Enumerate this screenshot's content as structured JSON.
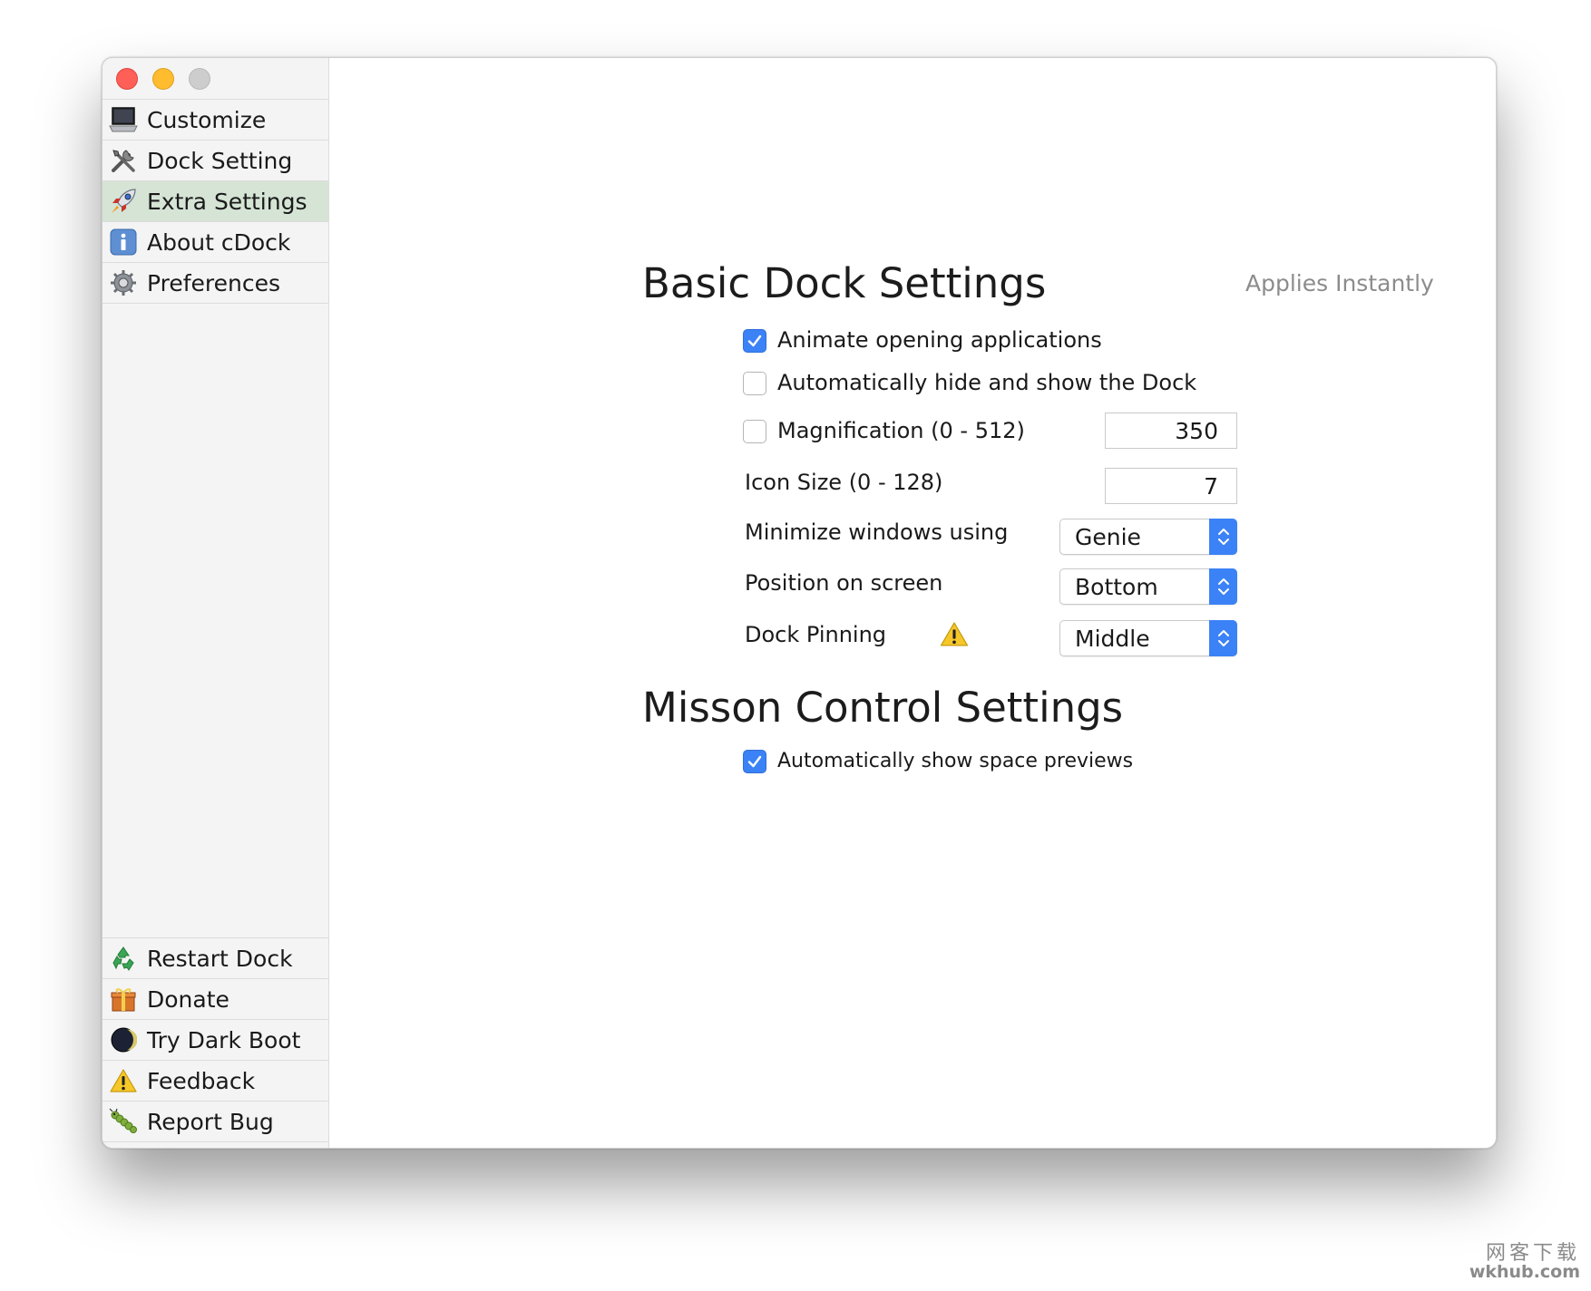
{
  "sidebar": {
    "top_items": [
      {
        "label": "Customize",
        "icon": "laptop-icon"
      },
      {
        "label": "Dock Setting",
        "icon": "tools-icon"
      },
      {
        "label": "Extra Settings",
        "icon": "rocket-icon",
        "selected": true
      },
      {
        "label": "About cDock",
        "icon": "info-icon"
      },
      {
        "label": "Preferences",
        "icon": "gear-icon"
      }
    ],
    "bottom_items": [
      {
        "label": "Restart Dock",
        "icon": "recycle-icon"
      },
      {
        "label": "Donate",
        "icon": "gift-icon"
      },
      {
        "label": "Try Dark Boot",
        "icon": "moon-icon"
      },
      {
        "label": "Feedback",
        "icon": "warning-icon"
      },
      {
        "label": "Report Bug",
        "icon": "bug-icon"
      }
    ]
  },
  "basic": {
    "title": "Basic Dock Settings",
    "applies": "Applies Instantly",
    "animate": {
      "label": "Animate opening applications",
      "checked": true
    },
    "autohide": {
      "label": "Automatically hide and show the Dock",
      "checked": false
    },
    "magnification": {
      "label": "Magnification (0 - 512)",
      "checked": false,
      "value": "350"
    },
    "icon_size": {
      "label": "Icon Size (0 - 128)",
      "value": "7"
    },
    "minimize": {
      "label": "Minimize windows using",
      "value": "Genie"
    },
    "position": {
      "label": "Position on screen",
      "value": "Bottom"
    },
    "pinning": {
      "label": "Dock Pinning",
      "value": "Middle"
    }
  },
  "mission": {
    "title": "Misson Control Settings",
    "previews": {
      "label": "Automatically show space previews",
      "checked": true
    }
  },
  "watermark": {
    "chinese": "网客下载",
    "url": "wkhub.com"
  },
  "colors": {
    "accent": "#3b82f6",
    "selected_row": "#d5e4d5",
    "close": "#fe5f57",
    "minimize": "#febc2e"
  }
}
